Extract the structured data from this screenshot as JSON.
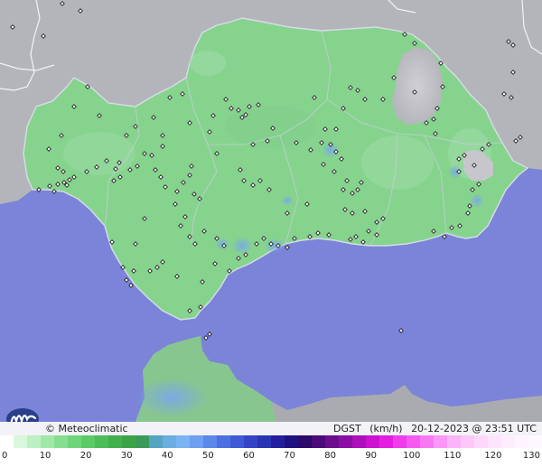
{
  "credit": {
    "copyright": "© Meteoclimatic"
  },
  "map_meta": {
    "variable": "DGST",
    "unit": "(km/h)",
    "timestamp": "20-12-2023 @ 23:51 UTC"
  },
  "legend": {
    "ticks": [
      "0",
      "10",
      "20",
      "30",
      "40",
      "50",
      "60",
      "70",
      "80",
      "90",
      "100",
      "110",
      "120",
      "130"
    ],
    "colors": [
      "#ffffff",
      "#d9f7dc",
      "#bdf0c2",
      "#a0e8a8",
      "#86df90",
      "#6fd57a",
      "#5bca67",
      "#4cbd59",
      "#42b04f",
      "#3aa347",
      "#3b9a5a",
      "#55a5c0",
      "#6aaee0",
      "#7ab4f2",
      "#6f9ff0",
      "#5b88ea",
      "#4c70e0",
      "#3f5ad4",
      "#3345c6",
      "#2a35b6",
      "#231f9c",
      "#1e1280",
      "#2a0a6a",
      "#4c0a7a",
      "#6a0e8c",
      "#8a0fa2",
      "#ac10ba",
      "#cc12d0",
      "#e41ee0",
      "#f03cea",
      "#f45af0",
      "#f878f4",
      "#f998f6",
      "#fbb4f8",
      "#fcc8f9",
      "#fdd8fb",
      "#fde4fc",
      "#feeefd",
      "#fff4fe",
      "#fff8fe"
    ]
  },
  "station_markers": [
    [
      14,
      30
    ],
    [
      48,
      40
    ],
    [
      69,
      4
    ],
    [
      89,
      12
    ],
    [
      97,
      96
    ],
    [
      110,
      128
    ],
    [
      82,
      118
    ],
    [
      68,
      150
    ],
    [
      54,
      165
    ],
    [
      64,
      186
    ],
    [
      70,
      190
    ],
    [
      82,
      196
    ],
    [
      96,
      190
    ],
    [
      107,
      185
    ],
    [
      118,
      178
    ],
    [
      128,
      187
    ],
    [
      133,
      196
    ],
    [
      43,
      210
    ],
    [
      55,
      206
    ],
    [
      64,
      204
    ],
    [
      71,
      202
    ],
    [
      77,
      199
    ],
    [
      60,
      212
    ],
    [
      74,
      205
    ],
    [
      126,
      200
    ],
    [
      152,
      184
    ],
    [
      160,
      170
    ],
    [
      168,
      172
    ],
    [
      172,
      188
    ],
    [
      178,
      196
    ],
    [
      183,
      207
    ],
    [
      196,
      212
    ],
    [
      203,
      202
    ],
    [
      210,
      194
    ],
    [
      212,
      184
    ],
    [
      215,
      215
    ],
    [
      221,
      220
    ],
    [
      194,
      226
    ],
    [
      205,
      240
    ],
    [
      200,
      250
    ],
    [
      226,
      256
    ],
    [
      240,
      264
    ],
    [
      248,
      272
    ],
    [
      238,
      292
    ],
    [
      254,
      300
    ],
    [
      264,
      286
    ],
    [
      272,
      282
    ],
    [
      284,
      270
    ],
    [
      292,
      264
    ],
    [
      300,
      270
    ],
    [
      308,
      272
    ],
    [
      318,
      274
    ],
    [
      326,
      264
    ],
    [
      343,
      262
    ],
    [
      352,
      258
    ],
    [
      364,
      260
    ],
    [
      388,
      265
    ],
    [
      394,
      262
    ],
    [
      402,
      268
    ],
    [
      408,
      256
    ],
    [
      417,
      246
    ],
    [
      424,
      242
    ],
    [
      480,
      256
    ],
    [
      492,
      262
    ],
    [
      500,
      252
    ],
    [
      509,
      250
    ],
    [
      518,
      236
    ],
    [
      520,
      228
    ],
    [
      523,
      210
    ],
    [
      530,
      204
    ],
    [
      525,
      183
    ],
    [
      508,
      190
    ],
    [
      508,
      176
    ],
    [
      514,
      172
    ],
    [
      534,
      165
    ],
    [
      541,
      160
    ],
    [
      571,
      156
    ],
    [
      576,
      152
    ],
    [
      566,
      108
    ],
    [
      568,
      80
    ],
    [
      558,
      104
    ],
    [
      568,
      50
    ],
    [
      563,
      46
    ],
    [
      488,
      70
    ],
    [
      490,
      96
    ],
    [
      484,
      120
    ],
    [
      480,
      132
    ],
    [
      482,
      148
    ],
    [
      472,
      136
    ],
    [
      459,
      102
    ],
    [
      459,
      48
    ],
    [
      448,
      38
    ],
    [
      436,
      86
    ],
    [
      424,
      110
    ],
    [
      404,
      110
    ],
    [
      396,
      100
    ],
    [
      388,
      97
    ],
    [
      380,
      120
    ],
    [
      372,
      143
    ],
    [
      360,
      143
    ],
    [
      356,
      158
    ],
    [
      366,
      160
    ],
    [
      372,
      168
    ],
    [
      378,
      176
    ],
    [
      370,
      190
    ],
    [
      358,
      182
    ],
    [
      384,
      200
    ],
    [
      380,
      210
    ],
    [
      390,
      214
    ],
    [
      396,
      210
    ],
    [
      400,
      202
    ],
    [
      382,
      232
    ],
    [
      390,
      236
    ],
    [
      404,
      234
    ],
    [
      417,
      260
    ],
    [
      340,
      226
    ],
    [
      318,
      236
    ],
    [
      298,
      210
    ],
    [
      280,
      205
    ],
    [
      288,
      200
    ],
    [
      270,
      200
    ],
    [
      266,
      188
    ],
    [
      280,
      160
    ],
    [
      296,
      156
    ],
    [
      302,
      142
    ],
    [
      286,
      116
    ],
    [
      276,
      118
    ],
    [
      272,
      127
    ],
    [
      264,
      122
    ],
    [
      268,
      130
    ],
    [
      256,
      120
    ],
    [
      250,
      110
    ],
    [
      236,
      128
    ],
    [
      232,
      146
    ],
    [
      210,
      136
    ],
    [
      202,
      104
    ],
    [
      188,
      108
    ],
    [
      170,
      130
    ],
    [
      150,
      140
    ],
    [
      140,
      150
    ],
    [
      132,
      180
    ],
    [
      180,
      150
    ],
    [
      180,
      162
    ],
    [
      144,
      188
    ],
    [
      240,
      170
    ],
    [
      328,
      158
    ],
    [
      344,
      166
    ],
    [
      348,
      108
    ],
    [
      196,
      306
    ],
    [
      210,
      344
    ],
    [
      160,
      242
    ],
    [
      150,
      270
    ],
    [
      124,
      268
    ],
    [
      136,
      296
    ],
    [
      140,
      310
    ],
    [
      148,
      300
    ],
    [
      145,
      316
    ],
    [
      166,
      300
    ],
    [
      174,
      296
    ],
    [
      180,
      290
    ],
    [
      222,
      340
    ],
    [
      224,
      312
    ],
    [
      216,
      270
    ],
    [
      210,
      262
    ],
    [
      232,
      370
    ],
    [
      228,
      374
    ],
    [
      444,
      366
    ]
  ]
}
